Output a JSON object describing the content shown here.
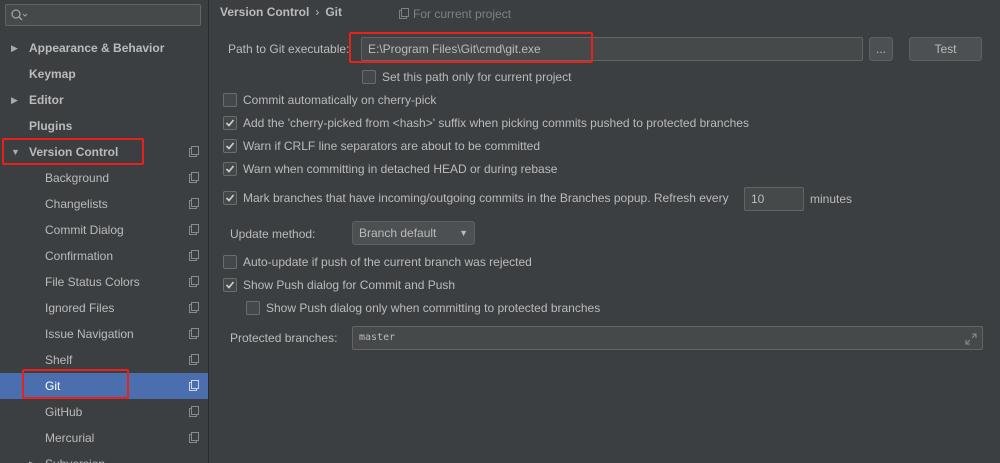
{
  "sidebar": {
    "search": {
      "value": "",
      "placeholder": ""
    },
    "items": [
      {
        "label": "Appearance & Behavior",
        "type": "top",
        "expanded": false
      },
      {
        "label": "Keymap",
        "type": "top"
      },
      {
        "label": "Editor",
        "type": "top",
        "expanded": false
      },
      {
        "label": "Plugins",
        "type": "top"
      },
      {
        "label": "Version Control",
        "type": "top",
        "expanded": true
      },
      {
        "label": "Background",
        "type": "child"
      },
      {
        "label": "Changelists",
        "type": "child"
      },
      {
        "label": "Commit Dialog",
        "type": "child"
      },
      {
        "label": "Confirmation",
        "type": "child"
      },
      {
        "label": "File Status Colors",
        "type": "child"
      },
      {
        "label": "Ignored Files",
        "type": "child"
      },
      {
        "label": "Issue Navigation",
        "type": "child"
      },
      {
        "label": "Shelf",
        "type": "child"
      },
      {
        "label": "Git",
        "type": "child",
        "selected": true
      },
      {
        "label": "GitHub",
        "type": "child"
      },
      {
        "label": "Mercurial",
        "type": "child"
      },
      {
        "label": "Subversion",
        "type": "child-expandable"
      }
    ]
  },
  "breadcrumb": {
    "parent": "Version Control",
    "separator": "›",
    "current": "Git"
  },
  "project_note": "For current project",
  "git_path": {
    "label": "Path to Git executable:",
    "value": "E:\\Program Files\\Git\\cmd\\git.exe",
    "browse_label": "...",
    "test_label": "Test"
  },
  "checkboxes": {
    "path_only_project": {
      "label": "Set this path only for current project",
      "checked": false
    },
    "commit_cherry_pick": {
      "label": "Commit automatically on cherry-pick",
      "checked": false
    },
    "cherry_picked_suffix": {
      "label": "Add the 'cherry-picked from <hash>' suffix when picking commits pushed to protected branches",
      "checked": true
    },
    "warn_crlf": {
      "label": "Warn if CRLF line separators are about to be committed",
      "checked": true
    },
    "warn_detached": {
      "label": "Warn when committing in detached HEAD or during rebase",
      "checked": true
    },
    "mark_branches": {
      "label": "Mark branches that have incoming/outgoing commits in the Branches popup.  Refresh every",
      "checked": true
    },
    "auto_update": {
      "label": "Auto-update if push of the current branch was rejected",
      "checked": false
    },
    "show_push": {
      "label": "Show Push dialog for Commit and Push",
      "checked": true
    },
    "show_push_protected": {
      "label": "Show Push dialog only when committing to protected branches",
      "checked": false
    }
  },
  "refresh": {
    "value": "10",
    "unit": "minutes"
  },
  "update_method": {
    "label": "Update method:",
    "value": "Branch default"
  },
  "protected_branches": {
    "label": "Protected branches:",
    "value": "master"
  },
  "colors": {
    "background": "#3c3f41",
    "selection": "#4b6eaf",
    "highlight": "#e8211d"
  }
}
